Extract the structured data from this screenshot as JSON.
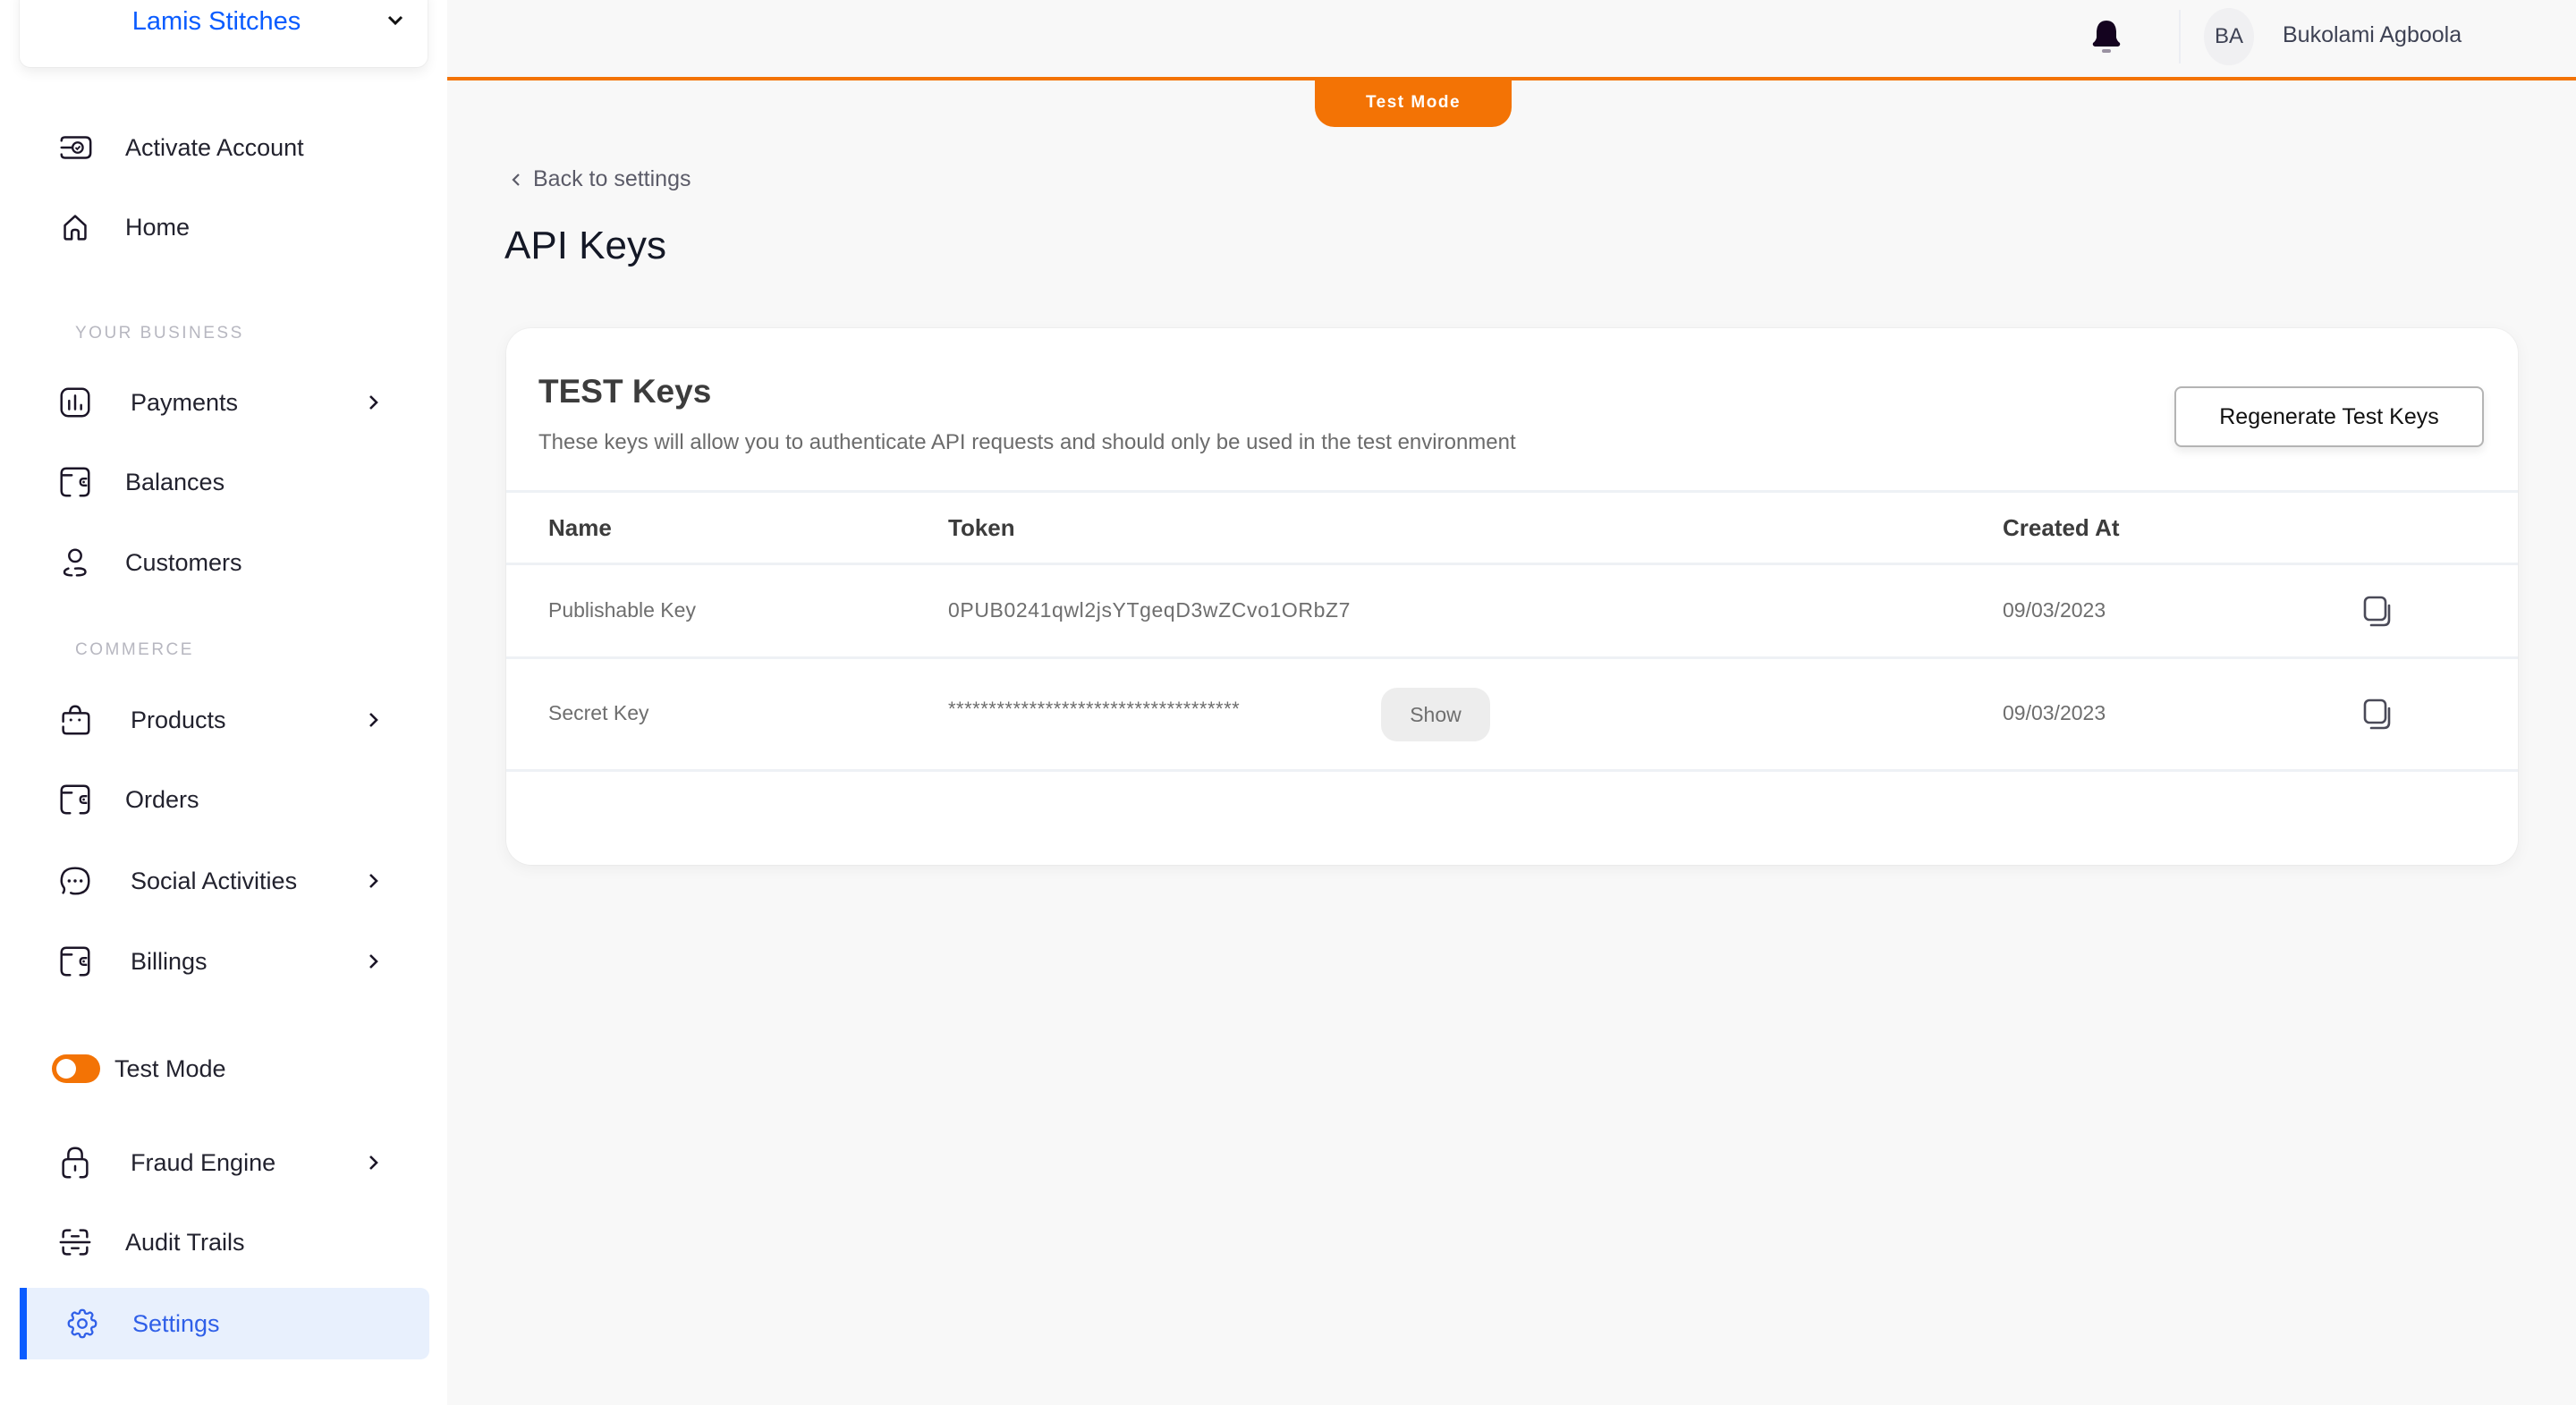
{
  "business_switcher": {
    "name": "Lamis Stitches",
    "icon": "chevron-down-icon"
  },
  "sidebar": {
    "top_items": [
      {
        "label": "Activate Account",
        "icon": "activate-account-icon"
      },
      {
        "label": "Home",
        "icon": "home-icon"
      }
    ],
    "sections": [
      {
        "title": "YOUR BUSINESS",
        "items": [
          {
            "label": "Payments",
            "icon": "chart-icon",
            "has_submenu": true
          },
          {
            "label": "Balances",
            "icon": "wallet-icon",
            "has_submenu": false
          },
          {
            "label": "Customers",
            "icon": "user-icon",
            "has_submenu": false
          }
        ]
      },
      {
        "title": "COMMERCE",
        "items": [
          {
            "label": "Products",
            "icon": "shopping-bag-icon",
            "has_submenu": true
          },
          {
            "label": "Orders",
            "icon": "wallet-icon",
            "has_submenu": false
          },
          {
            "label": "Social Activities",
            "icon": "chat-bubble-icon",
            "has_submenu": true
          },
          {
            "label": "Billings",
            "icon": "wallet-icon",
            "has_submenu": true
          }
        ]
      }
    ],
    "test_mode_toggle": {
      "label": "Test Mode",
      "enabled": true
    },
    "bottom_items": [
      {
        "label": "Fraud Engine",
        "icon": "lock-icon",
        "has_submenu": true
      },
      {
        "label": "Audit Trails",
        "icon": "scan-icon",
        "has_submenu": false
      },
      {
        "label": "Settings",
        "icon": "gear-icon",
        "active": true
      }
    ]
  },
  "header": {
    "user_initials": "BA",
    "user_name": "Bukolami Agboola",
    "notification_icon": "bell-icon",
    "mode_badge": "Test Mode"
  },
  "page": {
    "back_link": "Back to settings",
    "title": "API Keys"
  },
  "keys_card": {
    "title": "TEST Keys",
    "description": "These keys will allow you to authenticate API requests and should only be used in the test environment",
    "regenerate_button": "Regenerate Test Keys",
    "columns": [
      "Name",
      "Token",
      "Created At"
    ],
    "rows": [
      {
        "name": "Publishable Key",
        "token": "0PUB0241qwl2jsYTgeqD3wZCvo1ORbZ7",
        "created_at": "09/03/2023",
        "masked": false
      },
      {
        "name": "Secret Key",
        "token": "************************************",
        "created_at": "09/03/2023",
        "masked": true,
        "show_button": "Show"
      }
    ]
  },
  "colors": {
    "brand_blue": "#0a5cff",
    "test_mode_orange": "#f37305",
    "active_nav_bg": "#e8f0fd"
  }
}
